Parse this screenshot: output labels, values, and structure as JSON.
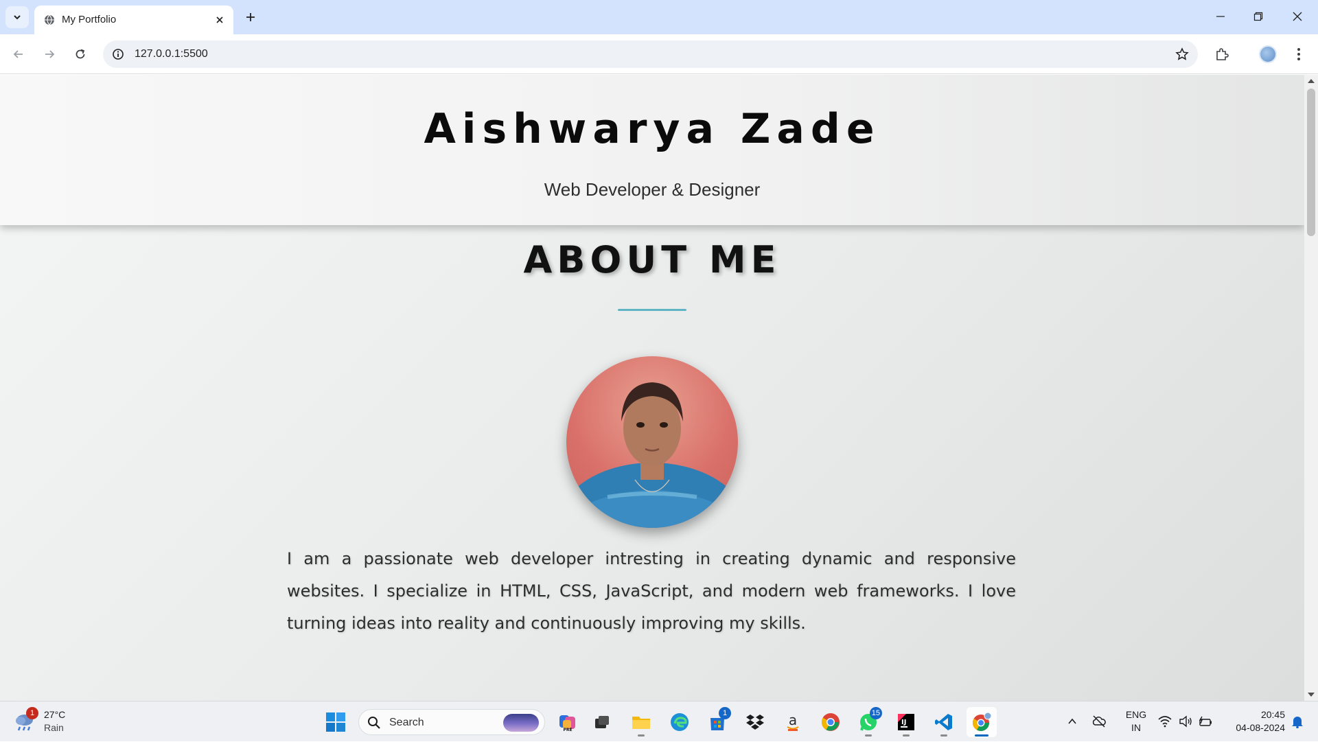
{
  "browser": {
    "tab_title": "My Portfolio",
    "url": "127.0.0.1:5500"
  },
  "page": {
    "name": "Aishwarya Zade",
    "tagline": "Web Developer & Designer",
    "about_heading": "ABOUT ME",
    "about_text": "I am a passionate web developer intresting in creating dynamic and responsive websites. I specialize in HTML, CSS, JavaScript, and modern web frameworks. I love turning ideas into reality and continuously improving my skills.",
    "accent_color": "#5fb4c4"
  },
  "taskbar": {
    "weather": {
      "temp": "27°C",
      "condition": "Rain",
      "badge": "1"
    },
    "search_label": "Search",
    "store_badge": "1",
    "whatsapp_badge": "15"
  },
  "tray": {
    "lang_line1": "ENG",
    "lang_line2": "IN",
    "time": "20:45",
    "date": "04-08-2024"
  }
}
